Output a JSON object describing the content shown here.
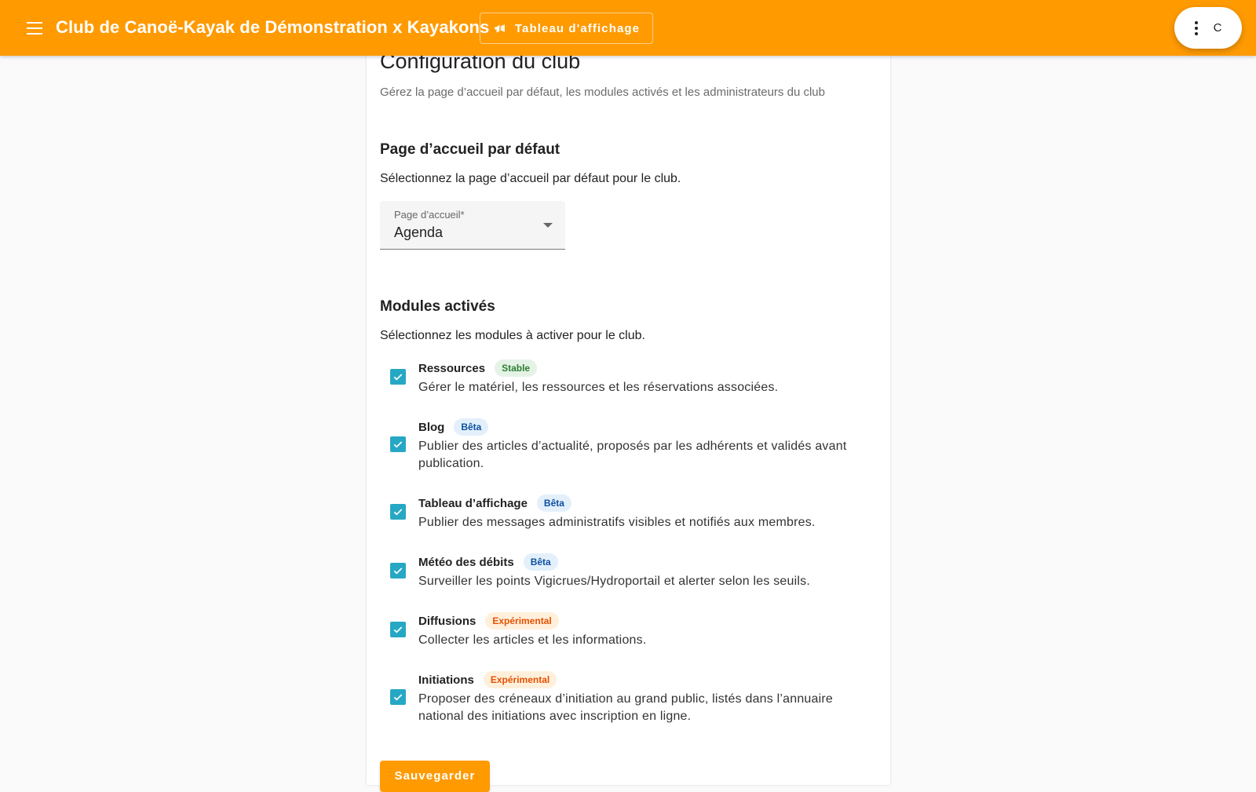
{
  "appbar": {
    "title": "Club de Canoë-Kayak de Démonstration x Kayakons",
    "board_button_label": "Tableau d'affichage",
    "avatar_letter": "C",
    "color": "#ff9a00"
  },
  "page": {
    "title": "Configuration du club",
    "subtitle": "Gérez la page d’accueil par défaut, les modules activés et les administrateurs du club"
  },
  "homepage_section": {
    "title": "Page d’accueil par défaut",
    "description": "Sélectionnez la page d’accueil par défaut pour le club.",
    "select_label": "Page d’accueil*",
    "select_value": "Agenda"
  },
  "modules_section": {
    "title": "Modules activés",
    "description": "Sélectionnez les modules à activer pour le club.",
    "modules": [
      {
        "name": "Ressources",
        "badge": "Stable",
        "badge_kind": "stable",
        "checked": true,
        "description": "Gérer le matériel, les ressources et les réservations associées."
      },
      {
        "name": "Blog",
        "badge": "Bêta",
        "badge_kind": "beta",
        "checked": true,
        "description": "Publier des articles d’actualité, proposés par les adhérents et validés avant publication."
      },
      {
        "name": "Tableau d’affichage",
        "badge": "Bêta",
        "badge_kind": "beta",
        "checked": true,
        "description": "Publier des messages administratifs visibles et notifiés aux membres."
      },
      {
        "name": "Météo des débits",
        "badge": "Bêta",
        "badge_kind": "beta",
        "checked": true,
        "description": "Surveiller les points Vigicrues/Hydroportail et alerter selon les seuils."
      },
      {
        "name": "Diffusions",
        "badge": "Expérimental",
        "badge_kind": "exp",
        "checked": true,
        "description": "Collecter les articles et les informations."
      },
      {
        "name": "Initiations",
        "badge": "Expérimental",
        "badge_kind": "exp",
        "checked": true,
        "description": "Proposer des créneaux d’initiation au grand public, listés dans l’annuaire national des initiations avec inscription en ligne."
      }
    ]
  },
  "actions": {
    "save_label": "Sauvegarder"
  }
}
